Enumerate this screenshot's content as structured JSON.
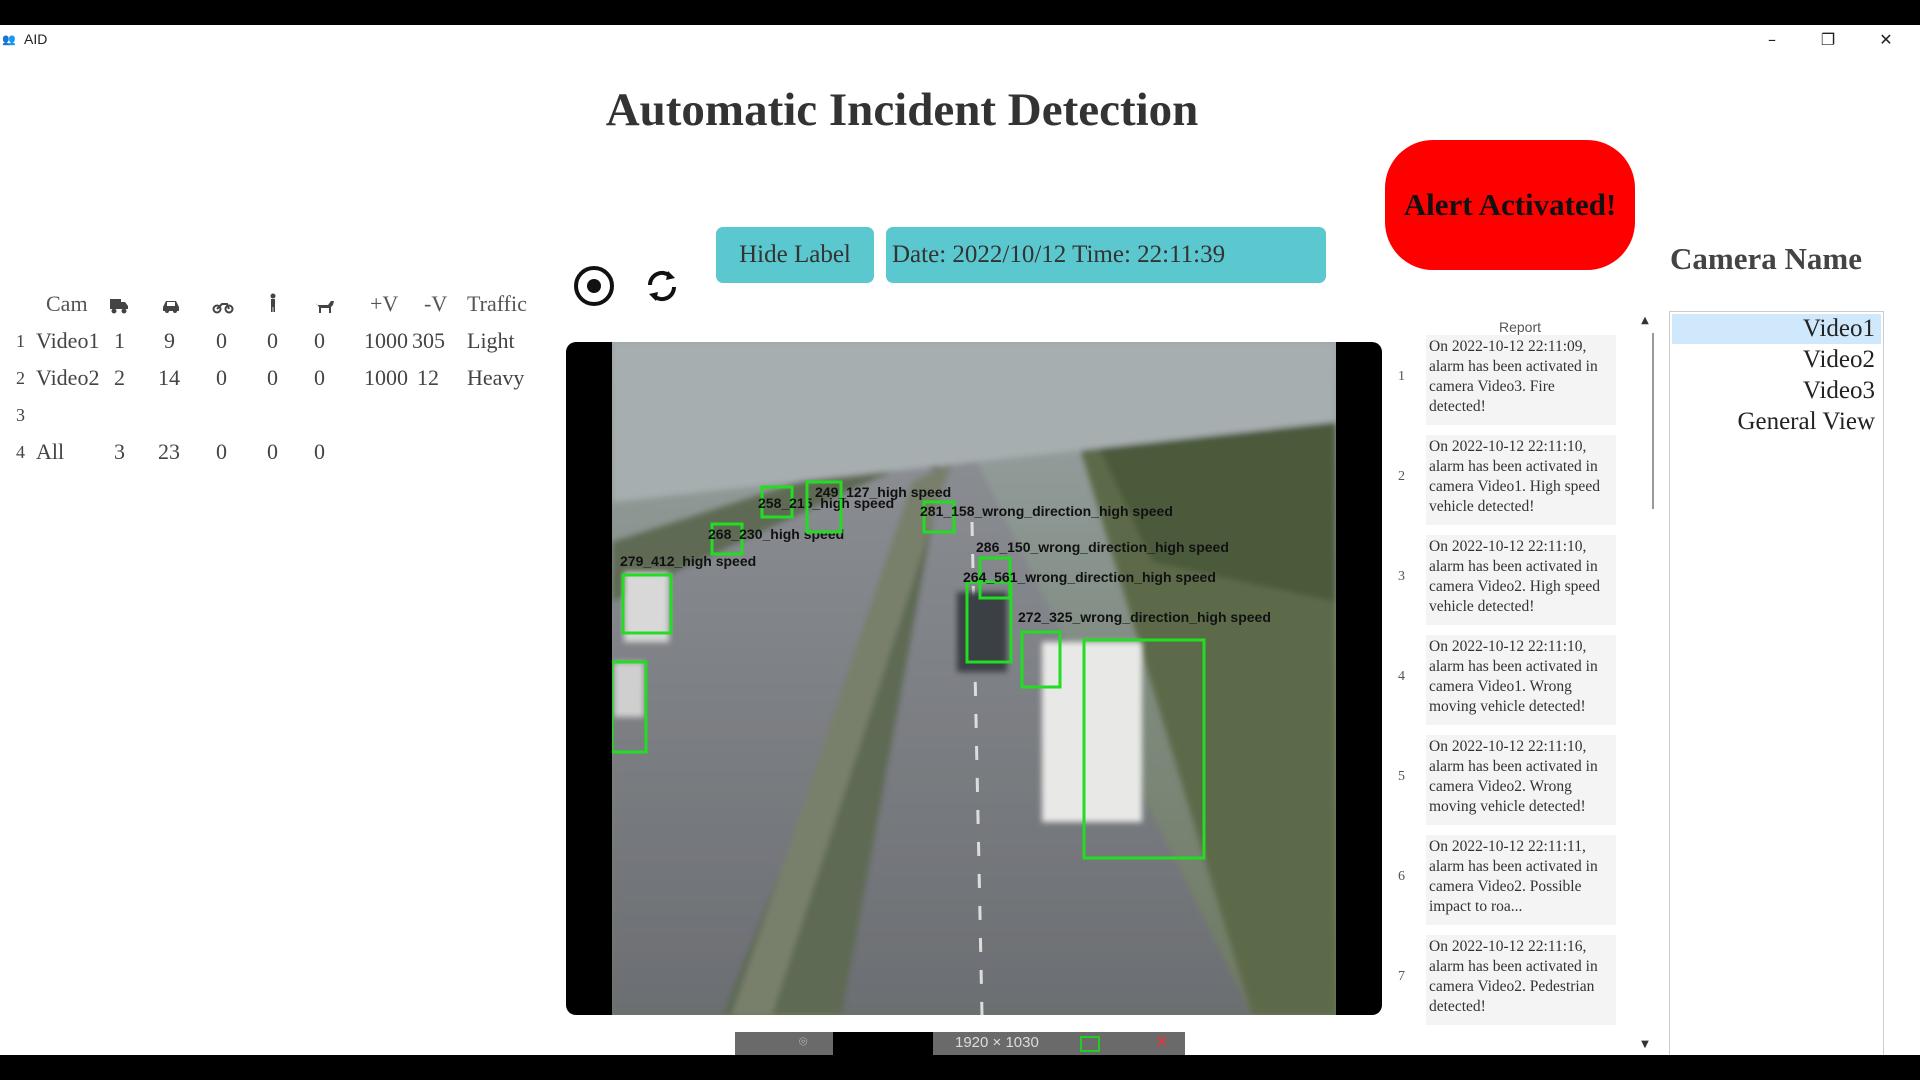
{
  "window": {
    "app_icon": "people-icon",
    "title": "AID",
    "controls": {
      "minimize": "–",
      "maximize": "❐",
      "close": "✕"
    }
  },
  "page_title": "Automatic Incident Detection",
  "stats_table": {
    "columns": [
      "Cam",
      "truck-icon",
      "car-icon",
      "motorcycle-icon",
      "pedestrian-icon",
      "animal-icon",
      "+V",
      "-V",
      "Traffic"
    ],
    "rows": [
      {
        "index": "1",
        "cam": "Video1",
        "truck": "1",
        "car": "9",
        "motorcycle": "0",
        "pedestrian": "0",
        "animal": "0",
        "plus_v": "1000",
        "minus_v": "305",
        "traffic": "Light"
      },
      {
        "index": "2",
        "cam": "Video2",
        "truck": "2",
        "car": "14",
        "motorcycle": "0",
        "pedestrian": "0",
        "animal": "0",
        "plus_v": "1000",
        "minus_v": "12",
        "traffic": "Heavy"
      },
      {
        "index": "3",
        "cam": "",
        "truck": "",
        "car": "",
        "motorcycle": "",
        "pedestrian": "",
        "animal": "",
        "plus_v": "",
        "minus_v": "",
        "traffic": ""
      },
      {
        "index": "4",
        "cam": "All",
        "truck": "3",
        "car": "23",
        "motorcycle": "0",
        "pedestrian": "0",
        "animal": "0",
        "plus_v": "",
        "minus_v": "",
        "traffic": ""
      }
    ]
  },
  "controls": {
    "stop_icon": "stop-record-icon",
    "refresh_icon": "refresh-icon",
    "hide_label": "Hide Label",
    "datetime": "Date: 2022/10/12  Time: 22:11:39"
  },
  "alert": {
    "label": "Alert Activated!",
    "color": "#ff0000"
  },
  "camera_name_title": "Camera Name",
  "cameras": [
    {
      "label": "Video1",
      "selected": true
    },
    {
      "label": "Video2",
      "selected": false
    },
    {
      "label": "Video3",
      "selected": false
    },
    {
      "label": "General View",
      "selected": false
    }
  ],
  "report": {
    "header": "Report",
    "entries": [
      {
        "num": "1",
        "text": "On 2022-10-12 22:11:09, alarm has been activated in camera Video3. Fire detected!"
      },
      {
        "num": "2",
        "text": "On 2022-10-12 22:11:10, alarm has been activated in camera Video1. High speed vehicle detected!"
      },
      {
        "num": "3",
        "text": "On 2022-10-12 22:11:10, alarm has been activated in camera Video2. High speed vehicle detected!"
      },
      {
        "num": "4",
        "text": "On 2022-10-12 22:11:10, alarm has been activated in camera Video1. Wrong moving vehicle detected!"
      },
      {
        "num": "5",
        "text": "On 2022-10-12 22:11:10, alarm has been activated in camera Video2. Wrong moving vehicle detected!"
      },
      {
        "num": "6",
        "text": "On 2022-10-12 22:11:11, alarm has been activated in camera Video2. Possible impact to roa..."
      },
      {
        "num": "7",
        "text": "On 2022-10-12 22:11:16, alarm has been activated in camera Video2. Pedestrian detected!"
      }
    ]
  },
  "video": {
    "detections": [
      {
        "label": "279_412_high speed"
      },
      {
        "label": "268_230_high speed"
      },
      {
        "label": "258_215_high speed"
      },
      {
        "label": "249_127_high speed"
      },
      {
        "label": "281_158_wrong_direction_high speed"
      },
      {
        "label": "286_150_wrong_direction_high speed"
      },
      {
        "label": "264_561_wrong_direction_high speed"
      },
      {
        "label": "272_325_wrong_direction_high speed"
      },
      {
        "label": ""
      },
      {
        "label": ""
      }
    ],
    "box_color": "#22dd22"
  },
  "taskbar": {
    "resolution": "1920 × 1030",
    "close": "✕"
  }
}
